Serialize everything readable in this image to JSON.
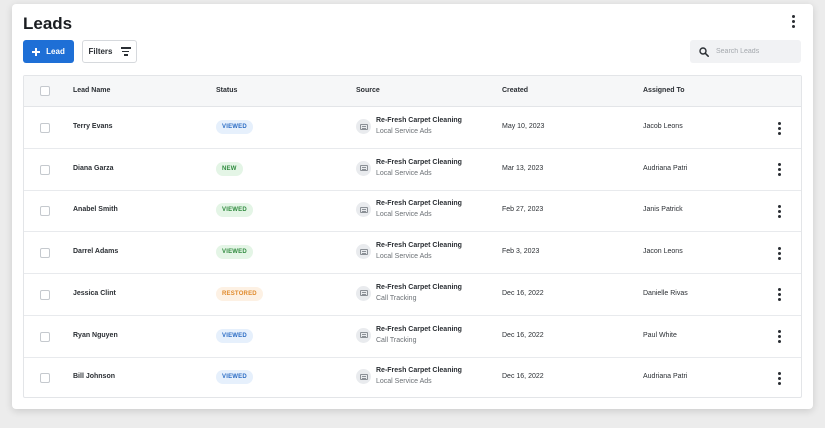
{
  "page": {
    "title": "Leads"
  },
  "toolbar": {
    "add_label": "Lead",
    "filters_label": "Filters",
    "search_placeholder": "Search Leads"
  },
  "colors": {
    "accent": "#1e6fd6",
    "viewed_bg": "#e6f0fc",
    "viewed_fg": "#2b6cc4",
    "new_bg": "#e4f5e6",
    "new_fg": "#2f8a3e",
    "restored_bg": "#fdf1e4",
    "restored_fg": "#e08a2c"
  },
  "table": {
    "columns": [
      "Lead Name",
      "Status",
      "Source",
      "Created",
      "Assigned To"
    ],
    "rows": [
      {
        "name": "Terry Evans",
        "status": "VIEWED",
        "status_type": "viewed",
        "source": "Re-Fresh Carpet Cleaning",
        "source_sub": "Local Service Ads",
        "created": "May 10, 2023",
        "assigned": "Jacob Leons"
      },
      {
        "name": "Diana Garza",
        "status": "NEW",
        "status_type": "new",
        "source": "Re-Fresh Carpet Cleaning",
        "source_sub": "Local Service Ads",
        "created": "Mar 13, 2023",
        "assigned": "Audriana Patri"
      },
      {
        "name": "Anabel Smith",
        "status": "VIEWED",
        "status_type": "viewed-green",
        "source": "Re-Fresh Carpet Cleaning",
        "source_sub": "Local Service Ads",
        "created": "Feb 27, 2023",
        "assigned": "Janis Patrick"
      },
      {
        "name": "Darrel Adams",
        "status": "VIEWED",
        "status_type": "viewed-green",
        "source": "Re-Fresh Carpet Cleaning",
        "source_sub": "Local Service Ads",
        "created": "Feb 3, 2023",
        "assigned": "Jacon Leons"
      },
      {
        "name": "Jessica Clint",
        "status": "RESTORED",
        "status_type": "restored",
        "source": "Re-Fresh Carpet Cleaning",
        "source_sub": "Call Tracking",
        "created": "Dec 16, 2022",
        "assigned": "Danielle Rivas"
      },
      {
        "name": "Ryan Nguyen",
        "status": "VIEWED",
        "status_type": "viewed",
        "source": "Re-Fresh Carpet Cleaning",
        "source_sub": "Call Tracking",
        "created": "Dec 16, 2022",
        "assigned": "Paul White"
      },
      {
        "name": "Bill Johnson",
        "status": "VIEWED",
        "status_type": "viewed",
        "source": "Re-Fresh Carpet Cleaning",
        "source_sub": "Local Service Ads",
        "created": "Dec 16, 2022",
        "assigned": "Audriana Patri"
      }
    ]
  },
  "icons": {
    "add": "plus-icon",
    "filter": "filter-icon",
    "search": "search-icon",
    "more": "more-vertical-icon",
    "source": "message-icon"
  }
}
